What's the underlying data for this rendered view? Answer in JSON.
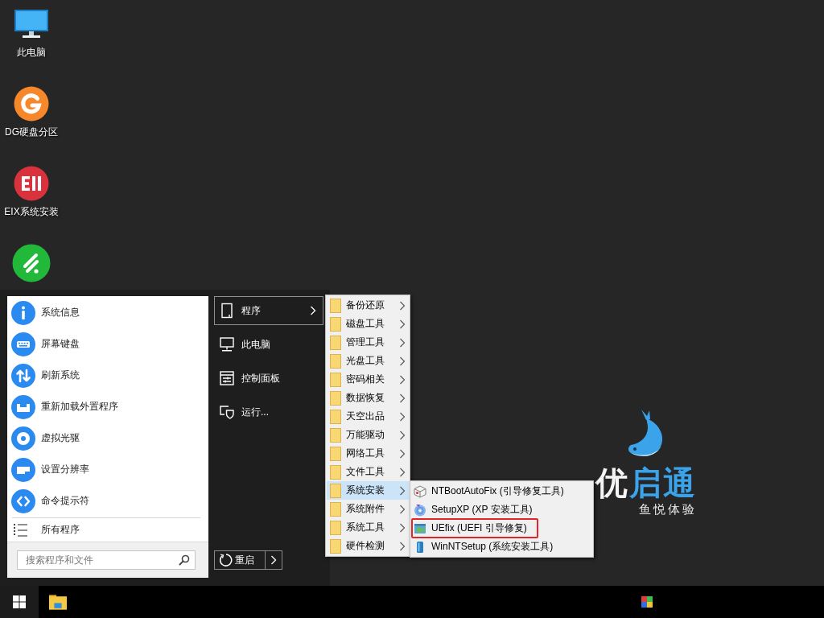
{
  "desktop_icons": [
    {
      "label": "此电脑",
      "kind": "computer"
    },
    {
      "label": "DG硬盘分区",
      "kind": "g-logo"
    },
    {
      "label": "EIX系统安装",
      "kind": "eii-logo"
    },
    {
      "kind": "leaf-logo"
    }
  ],
  "start_menu": {
    "quick_items": [
      {
        "label": "系统信息",
        "kind": "info"
      },
      {
        "label": "屏幕键盘",
        "kind": "keyboard"
      },
      {
        "label": "刷新系统",
        "kind": "refresh"
      },
      {
        "label": "重新加载外置程序",
        "kind": "tray"
      },
      {
        "label": "虚拟光驱",
        "kind": "disc"
      },
      {
        "label": "设置分辨率",
        "kind": "display"
      },
      {
        "label": "命令提示符",
        "kind": "code"
      }
    ],
    "all_programs": {
      "label": "所有程序"
    },
    "search": {
      "placeholder": "搜索程序和文件"
    },
    "places": [
      {
        "label": "程序",
        "kind": "programs",
        "selected": true,
        "submenu": true
      },
      {
        "label": "此电脑",
        "kind": "computer",
        "selected": false,
        "submenu": false
      },
      {
        "label": "控制面板",
        "kind": "control-panel",
        "selected": false,
        "submenu": false
      },
      {
        "label": "运行...",
        "kind": "run",
        "selected": false,
        "submenu": false
      }
    ],
    "power": {
      "label": "重启"
    }
  },
  "programs_menu": {
    "items": [
      {
        "label": "备份还原",
        "selected": false
      },
      {
        "label": "磁盘工具",
        "selected": false
      },
      {
        "label": "管理工具",
        "selected": false
      },
      {
        "label": "光盘工具",
        "selected": false
      },
      {
        "label": "密码相关",
        "selected": false
      },
      {
        "label": "数据恢复",
        "selected": false
      },
      {
        "label": "天空出品",
        "selected": false
      },
      {
        "label": "万能驱动",
        "selected": false
      },
      {
        "label": "网络工具",
        "selected": false
      },
      {
        "label": "文件工具",
        "selected": false
      },
      {
        "label": "系统安装",
        "selected": true
      },
      {
        "label": "系统附件",
        "selected": false
      },
      {
        "label": "系统工具",
        "selected": false
      },
      {
        "label": "硬件检测",
        "selected": false
      }
    ]
  },
  "install_menu": {
    "items": [
      {
        "label": "NTBootAutoFix (引导修复工具)",
        "kind": "box",
        "highlighted": false
      },
      {
        "label": "SetupXP (XP 安装工具)",
        "kind": "setup-disc",
        "highlighted": false
      },
      {
        "label": "UEfix (UEFI 引导修复)",
        "kind": "app",
        "highlighted": true
      },
      {
        "label": "WinNTSetup (系统安装工具)",
        "kind": "drive",
        "highlighted": false
      }
    ]
  },
  "logo": {
    "name_lead": "优",
    "name_rest": "启通",
    "tagline": "鱼悦体验"
  }
}
